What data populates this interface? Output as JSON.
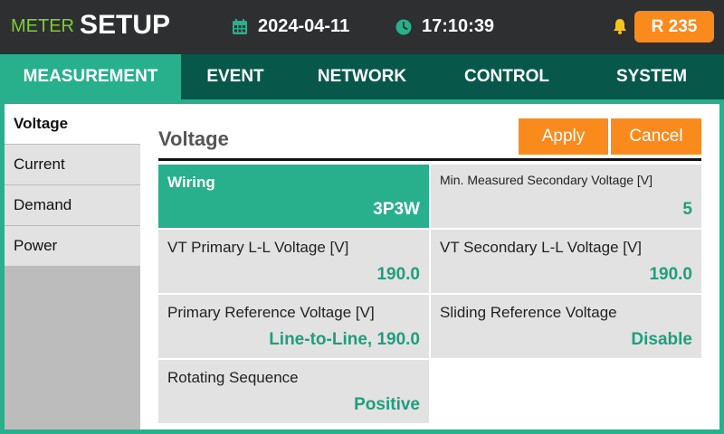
{
  "header": {
    "meter_label": "METER",
    "title": "SETUP",
    "date": "2024-04-11",
    "time": "17:10:39",
    "badge": "R 235",
    "icons": [
      "calendar-icon",
      "clock-icon",
      "bell-icon"
    ],
    "colors": {
      "meter": "#7bd12b",
      "accent": "#fb8a1c",
      "bell": "#f5c518",
      "clock": "#27b08b",
      "calendar": "#27b08b"
    }
  },
  "tabs": [
    {
      "label": "MEASUREMENT",
      "active": true
    },
    {
      "label": "EVENT",
      "active": false
    },
    {
      "label": "NETWORK",
      "active": false
    },
    {
      "label": "CONTROL",
      "active": false
    },
    {
      "label": "SYSTEM",
      "active": false
    }
  ],
  "sidebar": {
    "items": [
      {
        "label": "Voltage",
        "active": true
      },
      {
        "label": "Current",
        "active": false
      },
      {
        "label": "Demand",
        "active": false
      },
      {
        "label": "Power",
        "active": false
      }
    ]
  },
  "panel": {
    "title": "Voltage",
    "apply_label": "Apply",
    "cancel_label": "Cancel",
    "fields": [
      {
        "label": "Wiring",
        "value": "3P3W",
        "selected": true
      },
      {
        "label": "Min. Measured Secondary Voltage [V]",
        "value": "5",
        "selected": false
      },
      {
        "label": "VT Primary L-L Voltage [V]",
        "value": "190.0",
        "selected": false
      },
      {
        "label": "VT Secondary L-L Voltage [V]",
        "value": "190.0",
        "selected": false
      },
      {
        "label": "Primary Reference Voltage [V]",
        "value": "Line-to-Line, 190.0",
        "selected": false
      },
      {
        "label": "Sliding Reference Voltage",
        "value": "Disable",
        "selected": false
      },
      {
        "label": "Rotating Sequence",
        "value": "Positive",
        "selected": false
      }
    ]
  },
  "colors": {
    "primary": "#27b08b",
    "tabbar": "#07584b",
    "topbar": "#2d2f31",
    "cell": "#e2e2e2",
    "value": "#1f9e7d"
  }
}
